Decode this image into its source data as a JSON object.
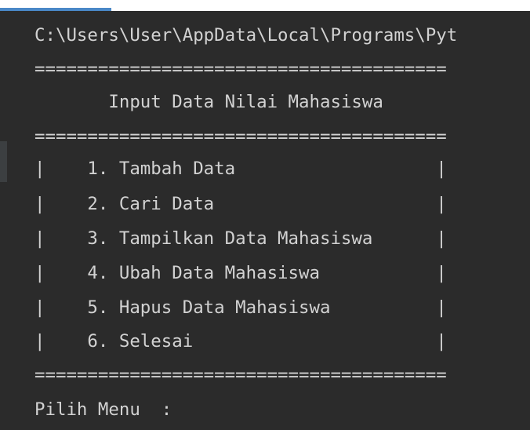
{
  "console": {
    "lines": [
      "C:\\Users\\User\\AppData\\Local\\Programs\\Pyt",
      "=======================================",
      "       Input Data Nilai Mahasiswa",
      "=======================================",
      "|    1. Tambah Data                   |",
      "|    2. Cari Data                     |",
      "|    3. Tampilkan Data Mahasiswa      |",
      "|    4. Ubah Data Mahasiswa           |",
      "|    5. Hapus Data Mahasiswa          |",
      "|    6. Selesai                       |",
      "=======================================",
      "Pilih Menu  :"
    ]
  },
  "colors": {
    "background": "#2b2b2b",
    "text": "#d2d2d2",
    "accent": "#4a88c7"
  }
}
